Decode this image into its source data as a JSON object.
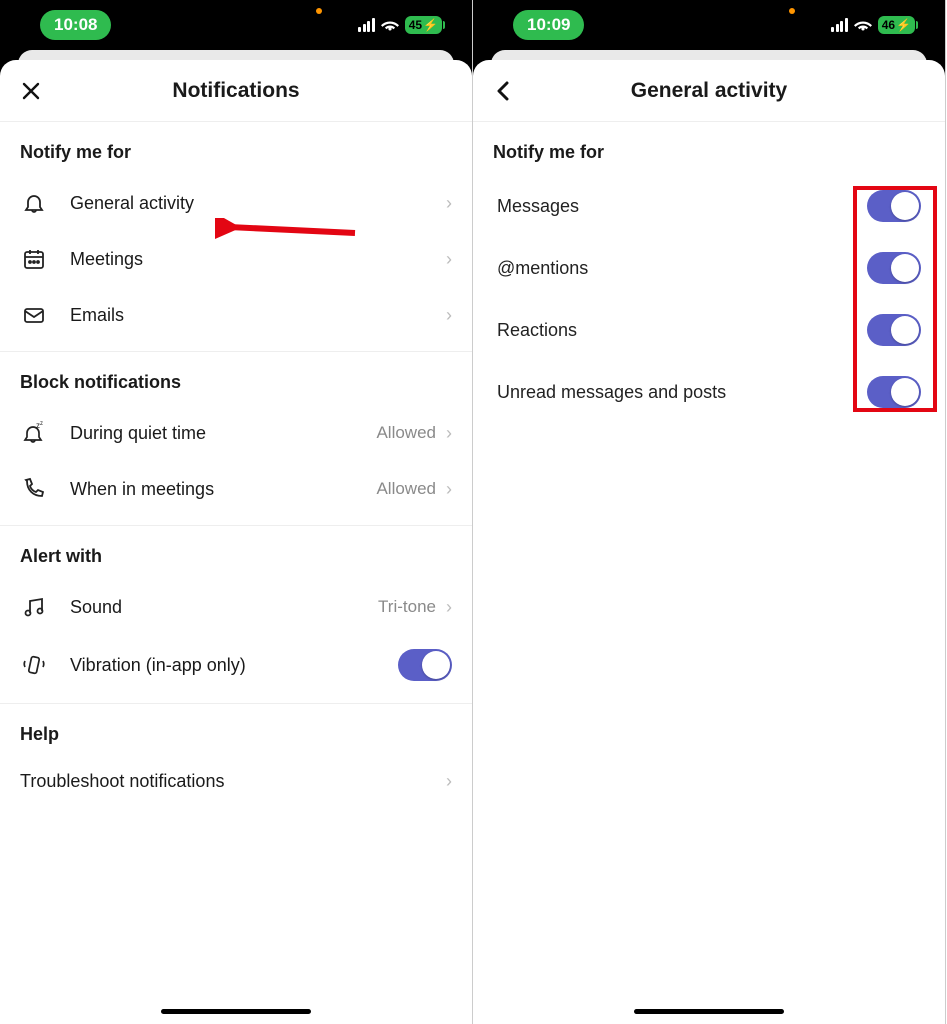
{
  "left": {
    "status": {
      "time": "10:08",
      "battery": "45"
    },
    "header": {
      "title": "Notifications"
    },
    "sections": {
      "notify": {
        "title": "Notify me for",
        "items": [
          {
            "label": "General activity"
          },
          {
            "label": "Meetings"
          },
          {
            "label": "Emails"
          }
        ]
      },
      "block": {
        "title": "Block notifications",
        "items": [
          {
            "label": "During quiet time",
            "value": "Allowed"
          },
          {
            "label": "When in meetings",
            "value": "Allowed"
          }
        ]
      },
      "alert": {
        "title": "Alert with",
        "items": [
          {
            "label": "Sound",
            "value": "Tri-tone"
          },
          {
            "label": "Vibration (in-app only)",
            "toggle": true
          }
        ]
      },
      "help": {
        "title": "Help",
        "items": [
          {
            "label": "Troubleshoot notifications"
          }
        ]
      }
    }
  },
  "right": {
    "status": {
      "time": "10:09",
      "battery": "46"
    },
    "header": {
      "title": "General activity"
    },
    "section_title": "Notify me for",
    "items": [
      {
        "label": "Messages",
        "on": true
      },
      {
        "label": "@mentions",
        "on": true
      },
      {
        "label": "Reactions",
        "on": true
      },
      {
        "label": "Unread messages and posts",
        "on": true
      }
    ]
  },
  "annotation": {
    "arrow_color": "#e30613",
    "highlight_color": "#e30613"
  }
}
